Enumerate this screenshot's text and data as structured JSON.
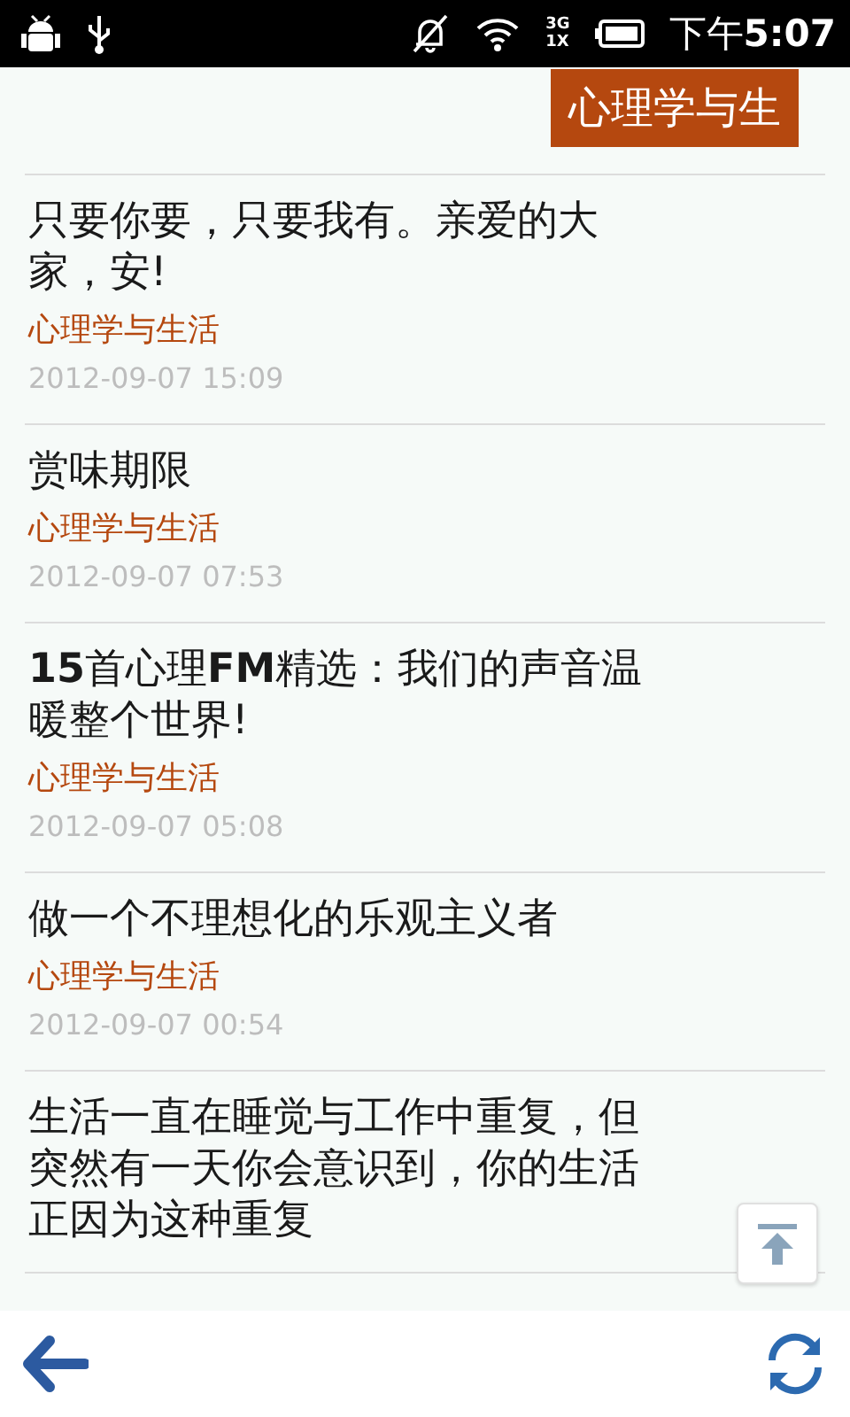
{
  "status_bar": {
    "time_prefix": "下午",
    "time": "5:07",
    "network_top": "3G",
    "network_bottom": "1X"
  },
  "header": {
    "tab": "心理学与生"
  },
  "articles": [
    {
      "title": "只要你要，只要我有。亲爱的大家，安!",
      "source": "心理学与生活",
      "date": "2012-09-07 15:09"
    },
    {
      "title": "赏味期限",
      "source": "心理学与生活",
      "date": "2012-09-07 07:53"
    },
    {
      "title": "**15**首心理**FM**精选：我们的声音温暖整个世界!",
      "source": "心理学与生活",
      "date": "2012-09-07 05:08"
    },
    {
      "title": "做一个不理想化的乐观主义者",
      "source": "心理学与生活",
      "date": "2012-09-07 00:54"
    },
    {
      "title": "生活一直在睡觉与工作中重复，但突然有一天你会意识到，你的生活正因为这种重复"
    }
  ]
}
